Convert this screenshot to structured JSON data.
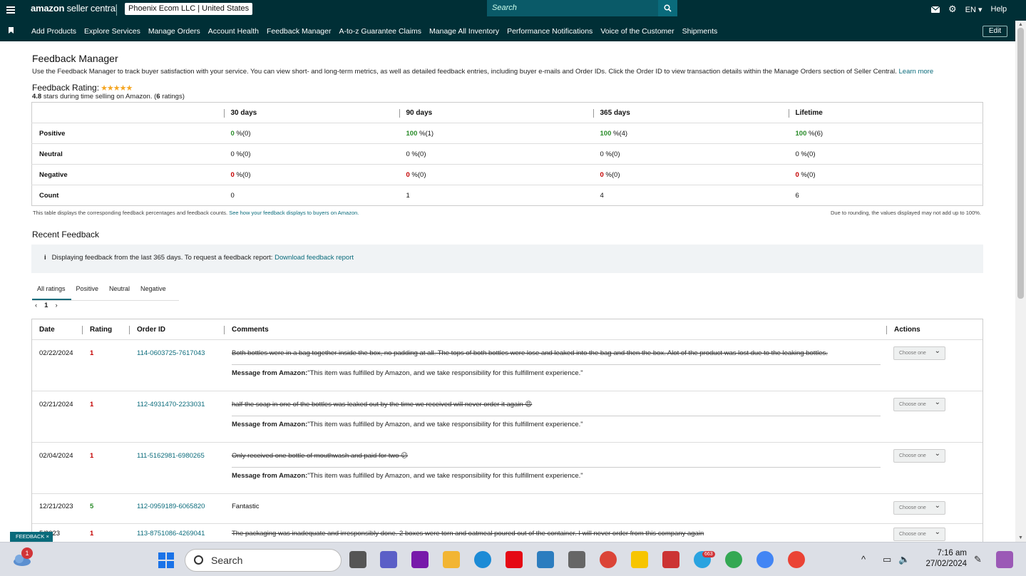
{
  "topbar": {
    "logo_brand": "amazon",
    "logo_text": " seller central",
    "account": "Phoenix Ecom LLC | United States",
    "search_placeholder": "Search",
    "language": "EN",
    "help": "Help"
  },
  "nav": {
    "items": [
      "Add Products",
      "Explore Services",
      "Manage Orders",
      "Account Health",
      "Feedback Manager",
      "A-to-z Guarantee Claims",
      "Manage All Inventory",
      "Performance Notifications",
      "Voice of the Customer",
      "Shipments"
    ],
    "edit": "Edit"
  },
  "page": {
    "title": "Feedback Manager",
    "description": "Use the Feedback Manager to track buyer satisfaction with your service. You can view short- and long-term metrics, as well as detailed feedback entries, including buyer e-mails and Order IDs. Click the Order ID to view transaction details within the Manage Orders section of Seller Central.",
    "learn_more": "Learn more",
    "rating_label": "Feedback Rating:",
    "rating_stars": 5,
    "rating_value": "4.8",
    "rating_mid": " stars during time selling on Amazon. (",
    "rating_count": "6",
    "rating_end": " ratings)"
  },
  "summary": {
    "columns": [
      "30 days",
      "90 days",
      "365 days",
      "Lifetime"
    ],
    "rows": [
      {
        "label": "Positive",
        "cells": [
          {
            "v": "0",
            "s": " %(0)"
          },
          {
            "v": "100",
            "s": " %(1)"
          },
          {
            "v": "100",
            "s": " %(4)"
          },
          {
            "v": "100",
            "s": " %(6)"
          }
        ]
      },
      {
        "label": "Neutral",
        "cells": [
          {
            "v": "0",
            "s": " %(0)"
          },
          {
            "v": "0",
            "s": " %(0)"
          },
          {
            "v": "0",
            "s": " %(0)"
          },
          {
            "v": "0",
            "s": " %(0)"
          }
        ]
      },
      {
        "label": "Negative",
        "cells": [
          {
            "v": "0",
            "s": " %(0)"
          },
          {
            "v": "0",
            "s": " %(0)"
          },
          {
            "v": "0",
            "s": " %(0)"
          },
          {
            "v": "0",
            "s": " %(0)"
          }
        ]
      },
      {
        "label": "Count",
        "cells": [
          {
            "v": "0",
            "s": ""
          },
          {
            "v": "1",
            "s": ""
          },
          {
            "v": "4",
            "s": ""
          },
          {
            "v": "6",
            "s": ""
          }
        ]
      }
    ],
    "note_left": "This table displays the corresponding feedback percentages and feedback counts.",
    "note_link": "See how your feedback displays to buyers on Amazon.",
    "note_right": "Due to rounding, the values displayed may not add up to 100%."
  },
  "recent": {
    "title": "Recent Feedback",
    "info": "Displaying feedback from the last 365 days. To request a feedback report:",
    "info_link": "Download feedback report",
    "tabs": [
      "All ratings",
      "Positive",
      "Neutral",
      "Negative"
    ],
    "page": "1",
    "headers": [
      "Date",
      "Rating",
      "Order ID",
      "Comments",
      "Actions"
    ],
    "msg_label": "Message from Amazon:",
    "msg_text": " \"This item was fulfilled by Amazon, and we take responsibility for this fulfillment experience.\"",
    "choose": "Choose one",
    "rows": [
      {
        "date": "02/22/2024",
        "rating": "1",
        "order": "114-0603725-7617043",
        "comment": "Both bottles were in a bag together inside the box, no padding at all. The tops of both bottles were lose and leaked into the bag and then the box. Alot of the product was lost due to the leaking bottles.",
        "struck": true,
        "msg": true
      },
      {
        "date": "02/21/2024",
        "rating": "1",
        "order": "112-4931470-2233031",
        "comment": "half the soap in one of the bottles was leaked out by the time we received will never order it again 😡",
        "struck": true,
        "msg": true
      },
      {
        "date": "02/04/2024",
        "rating": "1",
        "order": "111-5162981-6980265",
        "comment": "Only received one bottle of mouthwash and paid for two 😕",
        "struck": true,
        "msg": true
      },
      {
        "date": "12/21/2023",
        "rating": "5",
        "order": "112-0959189-6065820",
        "comment": "Fantastic",
        "struck": false,
        "msg": false
      },
      {
        "date": "5/2023",
        "rating": "1",
        "order": "113-8751086-4269041",
        "comment": "The packaging was inadequate and irresponsibly done. 2 boxes were torn and oatmeal poured out of the container. I will never order from this company again",
        "struck": true,
        "msg": false
      }
    ],
    "feedback_tab": "FEEDBACK"
  },
  "taskbar": {
    "search": "Search",
    "notif": "1",
    "telegram_badge": "663",
    "time": "7:16 am",
    "date": "27/02/2024"
  }
}
